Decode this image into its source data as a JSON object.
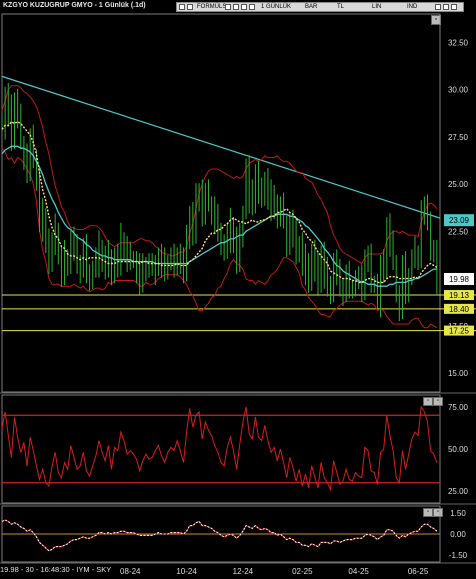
{
  "window": {
    "title": "KZGYO KUZUGRUP GMYO - 1 Günlük (.1d)",
    "toolbar": [
      "FORMÜLS",
      "1 GÜNLÜK",
      "BAR",
      "TL",
      "LIN",
      "IND"
    ]
  },
  "status_text": "19.98 - 30 - 16:48:30 - IYM - SKY",
  "colors": {
    "price_bars": "#2db52d",
    "bollinger": "#c01818",
    "ma_dotted": "#ffe27a",
    "ma_cyan": "#4fc7c9",
    "trendline": "#4fc7c9",
    "hline": "#e6e64a",
    "rsi": "#d61e1e",
    "osc": "#ffffff"
  },
  "chart_data": [
    {
      "type": "line",
      "panel": "price",
      "yticks": [
        "32.50",
        "30.00",
        "27.50",
        "25.00",
        "22.50",
        "20.00",
        "17.50",
        "15.00"
      ],
      "ytick_values": [
        32.5,
        30,
        27.5,
        25,
        22.5,
        20,
        17.5,
        15
      ],
      "ylim": [
        14,
        34
      ],
      "xticks": [
        "08-24",
        "10-24",
        "12-24",
        "02-25",
        "04-25",
        "06-25"
      ],
      "xtick_values": [
        41,
        59,
        77,
        96,
        114,
        133
      ],
      "xlim": [
        0,
        140
      ],
      "hlines": [
        {
          "value": 19.13,
          "label": "19.13"
        },
        {
          "value": 18.4,
          "label": "18.40"
        },
        {
          "value": 17.25,
          "label": "17.25"
        }
      ],
      "trendline": {
        "x": [
          0,
          140
        ],
        "y": [
          30.7,
          23.2
        ]
      },
      "tags": [
        {
          "value": 23.09,
          "label": "23.09",
          "color": "#4fc7c9"
        },
        {
          "value": 19.98,
          "label": "19.98",
          "color": "#ffffff"
        }
      ],
      "close": [
        28.2,
        29.6,
        28.8,
        27.4,
        29.4,
        28.4,
        27.2,
        26.6,
        25.8,
        27.2,
        26.4,
        25.1,
        22.8,
        23.4,
        22.1,
        20.9,
        21.7,
        22.5,
        21.1,
        20.4,
        21.2,
        20.8,
        22.0,
        21.4,
        20.6,
        20.8,
        21.5,
        20.4,
        19.9,
        20.4,
        20.9,
        21.6,
        21.1,
        20.6,
        21.2,
        20.1,
        21.1,
        20.9,
        22.0,
        21.6,
        20.9,
        21.1,
        20.9,
        20.6,
        19.9,
        20.4,
        20.7,
        20.5,
        20.5,
        20.9,
        21.1,
        20.7,
        20.4,
        20.8,
        21.0,
        20.9,
        21.3,
        20.9,
        20.3,
        21.9,
        23.4,
        22.6,
        24.2,
        24.7,
        23.3,
        24.3,
        23.9,
        23.7,
        23.1,
        22.6,
        21.8,
        21.4,
        22.2,
        22.8,
        22.1,
        20.9,
        22.1,
        23.5,
        25.8,
        24.3,
        24.1,
        25.6,
        24.5,
        24.2,
        25.3,
        24.5,
        23.8,
        24.0,
        23.2,
        23.7,
        23.0,
        22.0,
        22.9,
        22.3,
        21.3,
        21.8,
        20.5,
        21.0,
        20.0,
        21.3,
        20.4,
        19.6,
        21.3,
        20.3,
        19.8,
        19.3,
        20.8,
        20.1,
        19.4,
        19.5,
        20.1,
        19.6,
        19.5,
        19.9,
        19.8,
        19.6,
        21.1,
        21.0,
        19.8,
        19.7,
        18.8,
        20.5,
        20.6,
        22.8,
        21.7,
        20.9,
        19.1,
        18.6,
        20.5,
        19.3,
        20.1,
        20.9,
        21.4,
        21.3,
        23.6,
        23.5,
        23.1,
        21.4,
        21.2,
        19.98
      ],
      "bb_upper": [
        28.9,
        29.4,
        30.0,
        30.2,
        30.2,
        30.2,
        30.1,
        29.9,
        29.8,
        29.6,
        29.4,
        29.1,
        28.6,
        28.0,
        27.2,
        26.6,
        25.7,
        24.9,
        24.4,
        23.8,
        23.5,
        23.0,
        22.7,
        22.7,
        22.6,
        22.6,
        22.6,
        22.7,
        22.8,
        22.8,
        22.8,
        22.7,
        22.5,
        22.2,
        21.9,
        21.8,
        21.7,
        21.8,
        21.9,
        21.9,
        21.9,
        21.9,
        21.9,
        22.0,
        22.1,
        22.1,
        22.0,
        22.0,
        21.9,
        21.7,
        21.6,
        21.4,
        21.3,
        21.3,
        21.2,
        21.2,
        21.3,
        21.4,
        21.4,
        21.7,
        22.4,
        22.9,
        23.7,
        24.5,
        25.0,
        25.4,
        25.7,
        25.8,
        25.8,
        25.8,
        25.7,
        25.6,
        25.5,
        25.4,
        25.3,
        25.4,
        25.3,
        25.4,
        25.8,
        26.1,
        26.2,
        26.3,
        26.2,
        26.3,
        26.5,
        26.4,
        26.4,
        26.4,
        26.5,
        26.3,
        26.2,
        26.2,
        26.1,
        25.9,
        25.7,
        25.6,
        25.6,
        25.3,
        25.2,
        25.1,
        24.8,
        24.4,
        24.2,
        23.8,
        23.5,
        22.8,
        22.3,
        22.0,
        21.6,
        21.4,
        21.3,
        21.2,
        21.1,
        21.0,
        20.9,
        20.8,
        21.1,
        21.3,
        21.3,
        21.3,
        21.3,
        21.3,
        21.4,
        22.0,
        22.3,
        22.5,
        22.5,
        22.4,
        22.5,
        22.4,
        22.3,
        22.3,
        22.3,
        22.2,
        23.0,
        23.5,
        23.9,
        24.0,
        23.9,
        23.7
      ],
      "bb_lower": [
        26.9,
        26.7,
        26.3,
        26.4,
        26.1,
        26.4,
        26.3,
        26.1,
        25.8,
        25.5,
        25.0,
        24.1,
        22.6,
        21.5,
        20.9,
        20.0,
        19.7,
        19.7,
        19.7,
        19.6,
        19.6,
        19.6,
        19.6,
        19.7,
        19.6,
        19.5,
        19.6,
        19.4,
        19.3,
        19.4,
        19.5,
        19.5,
        19.4,
        19.5,
        19.8,
        19.7,
        19.9,
        19.9,
        19.9,
        19.9,
        19.9,
        19.9,
        19.9,
        19.8,
        19.6,
        19.6,
        19.8,
        19.7,
        19.7,
        19.8,
        20.0,
        20.1,
        20.2,
        20.2,
        20.2,
        20.2,
        20.2,
        20.1,
        19.9,
        19.7,
        19.3,
        19.1,
        18.7,
        18.3,
        18.3,
        18.5,
        18.7,
        19.0,
        19.1,
        19.5,
        19.6,
        20.0,
        20.3,
        20.8,
        21.0,
        20.8,
        20.7,
        20.5,
        20.0,
        19.9,
        19.9,
        19.7,
        19.9,
        19.8,
        19.7,
        19.9,
        20.2,
        20.3,
        20.5,
        20.8,
        21.1,
        21.1,
        21.0,
        20.9,
        20.6,
        20.3,
        19.6,
        19.4,
        19.0,
        18.8,
        18.6,
        18.3,
        18.1,
        18.1,
        18.0,
        18.0,
        18.3,
        18.4,
        18.6,
        18.7,
        18.8,
        18.8,
        18.8,
        18.8,
        18.8,
        18.8,
        18.7,
        18.6,
        18.7,
        18.6,
        18.3,
        18.4,
        18.3,
        18.0,
        17.8,
        17.6,
        17.6,
        17.6,
        17.6,
        17.6,
        17.6,
        17.8,
        17.9,
        17.9,
        17.6,
        17.4,
        17.4,
        17.6,
        17.5,
        17.4
      ],
      "ma_dotted": [
        27.9,
        28.1,
        28.1,
        28.3,
        28.2,
        28.3,
        28.2,
        28.0,
        27.8,
        27.6,
        27.2,
        26.6,
        25.6,
        24.7,
        24.1,
        23.3,
        22.7,
        22.3,
        22.1,
        21.7,
        21.6,
        21.3,
        21.2,
        21.2,
        21.1,
        21.0,
        21.1,
        21.0,
        21.1,
        21.1,
        21.1,
        21.1,
        21.0,
        20.9,
        20.8,
        20.8,
        20.8,
        20.9,
        20.9,
        20.9,
        20.9,
        20.9,
        20.9,
        20.9,
        20.8,
        20.9,
        20.9,
        20.8,
        20.8,
        20.8,
        20.8,
        20.7,
        20.7,
        20.7,
        20.7,
        20.7,
        20.8,
        20.7,
        20.7,
        20.7,
        20.9,
        21.0,
        21.2,
        21.4,
        21.6,
        22.0,
        22.2,
        22.4,
        22.4,
        22.6,
        22.6,
        22.8,
        22.9,
        23.1,
        23.2,
        23.1,
        23.0,
        23.0,
        22.9,
        23.0,
        23.1,
        23.0,
        23.0,
        23.1,
        23.1,
        23.2,
        23.3,
        23.3,
        23.5,
        23.5,
        23.6,
        23.7,
        23.5,
        23.4,
        23.2,
        23.0,
        22.6,
        22.4,
        22.1,
        22.0,
        21.7,
        21.4,
        21.2,
        21.0,
        20.8,
        20.4,
        20.3,
        20.2,
        20.1,
        20.0,
        20.0,
        20.0,
        19.9,
        19.9,
        19.8,
        19.8,
        19.9,
        20.0,
        20.0,
        19.9,
        19.8,
        19.8,
        19.8,
        20.0,
        20.1,
        20.1,
        20.1,
        20.0,
        20.0,
        20.0,
        20.0,
        20.0,
        20.1,
        20.0,
        20.3,
        20.5,
        20.7,
        20.8,
        20.7,
        20.6
      ],
      "ma_cyan": [
        26.6,
        26.8,
        26.9,
        27.0,
        27.0,
        27.0,
        26.9,
        26.9,
        26.8,
        26.7,
        26.5,
        26.2,
        25.9,
        25.5,
        25.0,
        24.6,
        24.2,
        23.9,
        23.5,
        23.2,
        22.9,
        22.7,
        22.6,
        22.4,
        22.2,
        22.1,
        22.0,
        21.8,
        21.7,
        21.5,
        21.4,
        21.3,
        21.2,
        21.2,
        21.1,
        21.1,
        21.0,
        21.0,
        21.0,
        21.0,
        21.0,
        21.0,
        20.9,
        20.9,
        20.9,
        20.9,
        20.9,
        20.9,
        20.9,
        20.8,
        20.8,
        20.8,
        20.8,
        20.8,
        20.8,
        20.8,
        20.8,
        20.8,
        20.8,
        20.8,
        20.9,
        21.0,
        21.1,
        21.2,
        21.3,
        21.4,
        21.5,
        21.6,
        21.7,
        21.8,
        21.9,
        21.9,
        22.0,
        22.1,
        22.1,
        22.2,
        22.3,
        22.3,
        22.5,
        22.6,
        22.7,
        22.8,
        22.9,
        23.0,
        23.1,
        23.2,
        23.3,
        23.3,
        23.4,
        23.4,
        23.4,
        23.4,
        23.3,
        23.3,
        23.2,
        23.1,
        23.0,
        22.8,
        22.7,
        22.5,
        22.3,
        22.1,
        21.9,
        21.6,
        21.4,
        21.2,
        20.9,
        20.7,
        20.6,
        20.4,
        20.3,
        20.2,
        20.1,
        20.0,
        19.9,
        19.8,
        19.8,
        19.7,
        19.7,
        19.7,
        19.6,
        19.6,
        19.6,
        19.6,
        19.7,
        19.7,
        19.8,
        19.8,
        19.8,
        19.8,
        19.9,
        19.9,
        20.0,
        20.0,
        20.1,
        20.2,
        20.3,
        20.4,
        20.5,
        20.5
      ]
    },
    {
      "type": "line",
      "panel": "oscillator_1",
      "yticks": [
        "75.00",
        "50.00",
        "25.00"
      ],
      "ytick_values": [
        75,
        50,
        25
      ],
      "ylim": [
        18,
        82
      ],
      "hlines": [
        {
          "value": 70
        },
        {
          "value": 30
        }
      ],
      "values": [
        62,
        72,
        58,
        45,
        69,
        57,
        48,
        54,
        40,
        57,
        49,
        40,
        32,
        38,
        30,
        28,
        40,
        48,
        36,
        33,
        42,
        38,
        52,
        45,
        38,
        40,
        48,
        37,
        34,
        40,
        46,
        55,
        48,
        43,
        52,
        38,
        51,
        49,
        60,
        55,
        47,
        49,
        47,
        44,
        37,
        43,
        47,
        44,
        45,
        49,
        52,
        46,
        42,
        48,
        51,
        49,
        55,
        49,
        42,
        60,
        74,
        63,
        70,
        72,
        56,
        66,
        61,
        58,
        52,
        48,
        42,
        40,
        51,
        57,
        49,
        38,
        53,
        66,
        75,
        59,
        56,
        69,
        57,
        55,
        64,
        55,
        48,
        51,
        43,
        50,
        42,
        33,
        45,
        39,
        31,
        38,
        28,
        35,
        27,
        40,
        33,
        27,
        42,
        33,
        30,
        26,
        43,
        36,
        29,
        31,
        38,
        32,
        31,
        36,
        34,
        33,
        51,
        49,
        37,
        36,
        29,
        48,
        50,
        70,
        58,
        49,
        33,
        30,
        49,
        38,
        47,
        56,
        60,
        58,
        75,
        72,
        66,
        49,
        47,
        42
      ]
    },
    {
      "type": "line",
      "panel": "oscillator_2",
      "yticks": [
        "1.50",
        "0.00",
        "-1.50"
      ],
      "ytick_values": [
        1.5,
        0,
        -1.5
      ],
      "ylim": [
        -2,
        2
      ],
      "hlines": [
        {
          "value": 0
        }
      ],
      "values": [
        0.9,
        1.0,
        0.9,
        0.7,
        0.8,
        0.7,
        0.5,
        0.4,
        0.2,
        0.3,
        0.1,
        -0.2,
        -0.6,
        -0.8,
        -1.0,
        -1.2,
        -1.1,
        -0.9,
        -0.9,
        -0.9,
        -0.8,
        -0.7,
        -0.5,
        -0.4,
        -0.4,
        -0.3,
        -0.2,
        -0.3,
        -0.3,
        -0.2,
        -0.1,
        0.1,
        0.1,
        0.0,
        0.1,
        0.0,
        0.1,
        0.1,
        0.2,
        0.2,
        0.1,
        0.1,
        0.1,
        0.0,
        -0.1,
        -0.1,
        -0.1,
        -0.1,
        -0.1,
        0.0,
        0.1,
        0.0,
        0.0,
        0.0,
        0.1,
        0.1,
        0.1,
        0.1,
        0.0,
        0.2,
        0.6,
        0.6,
        0.8,
        0.9,
        0.6,
        0.6,
        0.5,
        0.4,
        0.2,
        0.1,
        -0.1,
        -0.2,
        -0.1,
        0.0,
        -0.1,
        -0.3,
        -0.1,
        0.2,
        0.6,
        0.5,
        0.4,
        0.6,
        0.4,
        0.3,
        0.4,
        0.3,
        0.1,
        0.1,
        -0.1,
        0.0,
        -0.2,
        -0.4,
        -0.3,
        -0.4,
        -0.6,
        -0.6,
        -0.8,
        -0.8,
        -0.9,
        -0.7,
        -0.8,
        -0.9,
        -0.6,
        -0.6,
        -0.6,
        -0.7,
        -0.5,
        -0.5,
        -0.6,
        -0.5,
        -0.4,
        -0.4,
        -0.4,
        -0.3,
        -0.3,
        -0.3,
        -0.1,
        0.0,
        -0.1,
        -0.2,
        -0.4,
        -0.2,
        -0.1,
        0.3,
        0.3,
        0.2,
        -0.1,
        -0.3,
        -0.1,
        -0.2,
        0.0,
        0.1,
        0.2,
        0.2,
        0.5,
        0.7,
        0.7,
        0.5,
        0.4,
        0.2
      ]
    }
  ]
}
